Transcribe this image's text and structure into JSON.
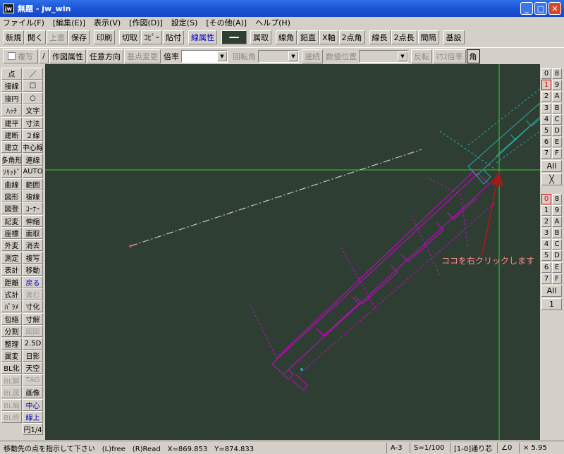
{
  "window": {
    "app_icon": "jw",
    "title": "無題 - jw_win"
  },
  "menu": [
    "ファイル(F)",
    "[編集(E)]",
    "表示(V)",
    "[作図(D)]",
    "設定(S)",
    "[その他(A)]",
    "ヘルプ(H)"
  ],
  "toolbar1": {
    "file": [
      "新規",
      "開く",
      "上書",
      "保存"
    ],
    "edit": [
      "印刷",
      "切取",
      "ｺﾋﾟｰ",
      "貼付"
    ],
    "attr": "線属性",
    "misc": [
      "属取",
      "線角",
      "鉛直",
      "X軸",
      "2点角",
      "線長",
      "2点長",
      "間隔",
      "基設"
    ]
  },
  "toolbar2": {
    "copy_label": "複写",
    "draw_attr": "作図属性",
    "free_dir": "任意方向",
    "base_change": "基点変更",
    "scale_label": "倍率",
    "rotate_label": "回転角",
    "continue": "連続",
    "num_pos_label": "数値位置",
    "flip": "反転",
    "mouse_scale": "ﾏｳｽ倍率",
    "corner": "角"
  },
  "left_tools": [
    [
      "点",
      "／"
    ],
    [
      "接線",
      "□"
    ],
    [
      "接円",
      "○"
    ],
    [
      "ﾊｯﾁ",
      "文字"
    ],
    [
      "建平",
      "寸法"
    ],
    [
      "建断",
      "２線"
    ],
    [
      "建立",
      "中心線"
    ],
    [
      "多角形",
      "連線"
    ],
    [
      "ｿﾘｯﾄﾞ",
      "AUTO"
    ],
    [
      "曲線",
      "範囲"
    ],
    [
      "図形",
      "複線"
    ],
    [
      "図登",
      "ｺｰﾅｰ"
    ],
    [
      "記変",
      "伸縮"
    ],
    [
      "座標",
      "面取"
    ],
    [
      "外変",
      "消去"
    ],
    [
      "測定",
      "複写"
    ],
    [
      "表計",
      "移動"
    ],
    [
      "距離",
      "戻る"
    ],
    [
      "式計",
      "進む"
    ],
    [
      "ﾊﾟﾗﾒ",
      "寸化"
    ],
    [
      "包絡",
      "寸解"
    ],
    [
      "分割",
      "図図"
    ],
    [
      "整理",
      "2.5D"
    ],
    [
      "属変",
      "日影"
    ],
    [
      "BL化",
      "天空"
    ],
    [
      "BL解",
      "TAG"
    ],
    [
      "BL属",
      "画像"
    ],
    [
      "BL編",
      "中心"
    ],
    [
      "BL終",
      "線上"
    ],
    [
      "",
      "円1/4"
    ]
  ],
  "right_panel": {
    "layer_rows": [
      [
        "0",
        "8"
      ],
      [
        "1",
        "9"
      ],
      [
        "2",
        "A"
      ],
      [
        "3",
        "B"
      ],
      [
        "4",
        "C"
      ],
      [
        "5",
        "D"
      ],
      [
        "6",
        "E"
      ],
      [
        "7",
        "F"
      ]
    ],
    "all": "All",
    "cross": "╳",
    "group_rows": [
      [
        "0",
        "8"
      ],
      [
        "1",
        "9"
      ],
      [
        "2",
        "A"
      ],
      [
        "3",
        "B"
      ],
      [
        "4",
        "C"
      ],
      [
        "5",
        "D"
      ],
      [
        "6",
        "E"
      ],
      [
        "7",
        "F"
      ]
    ],
    "all2": "All",
    "one": "1"
  },
  "callout": {
    "text": "ココを右クリックします",
    "color": "#ff8a8a"
  },
  "status": {
    "message": "移動先の点を指示して下さい　(L)free　(R)Read　X=869.853　Y=874.833",
    "paper": "A-3",
    "scale": "S=1/100",
    "layer": "[1-0]通り芯",
    "angle": "∠0",
    "zoom": "× 5.95"
  },
  "colors": {
    "canvas": "#2f3e33",
    "magenta": "#d400d4",
    "cyan": "#25a8a8",
    "green": "#2bd62b",
    "arrow": "#9b1c1c"
  }
}
